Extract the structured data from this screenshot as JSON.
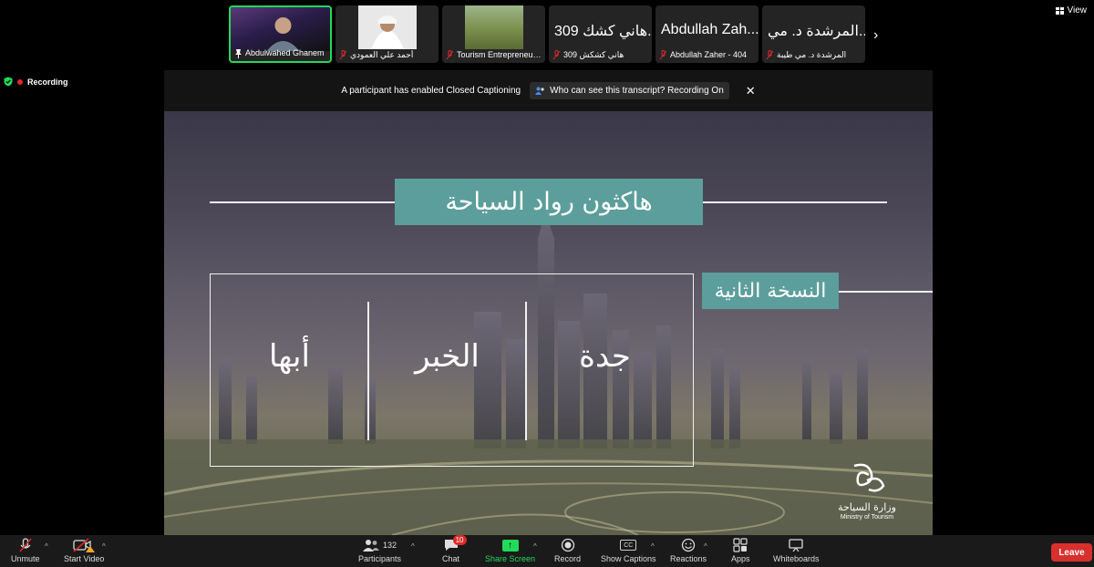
{
  "participants": [
    {
      "name": "Abdulwahed Ghanem",
      "active": true
    },
    {
      "name": "أحمد علي العمودي"
    },
    {
      "name": "Tourism Entrepreneur..."
    },
    {
      "display": "309 هاني كشك...",
      "name": "309 هاني كشكش"
    },
    {
      "display": "Abdullah Zah...",
      "name": "Abdullah Zaher - 404"
    },
    {
      "display": "المرشدة د. مي...",
      "name": "المرشدة د. مي طيبة"
    }
  ],
  "view_label": "View",
  "recording_label": "Recording",
  "cc_banner": {
    "message": "A participant has enabled Closed Captioning",
    "transcript": "Who can see this transcript? Recording On"
  },
  "slide": {
    "title": "هاكثون رواد السياحة",
    "edition": "النسخة الثانية",
    "cities": [
      "أبها",
      "الخبر",
      "جدة"
    ],
    "ministry_ar": "وزارة السياحة",
    "ministry_en": "Ministry of Tourism"
  },
  "toolbar": {
    "unmute": "Unmute",
    "start_video": "Start Video",
    "participants": "Participants",
    "participants_count": "132",
    "chat": "Chat",
    "chat_badge": "10",
    "share_screen": "Share Screen",
    "record": "Record",
    "show_captions": "Show Captions",
    "cc_icon_text": "CC",
    "reactions": "Reactions",
    "apps": "Apps",
    "whiteboards": "Whiteboards",
    "leave": "Leave"
  },
  "colors": {
    "accent_green": "#23d959",
    "teal_box": "#5c9e9b",
    "leave_red": "#d9302e"
  }
}
